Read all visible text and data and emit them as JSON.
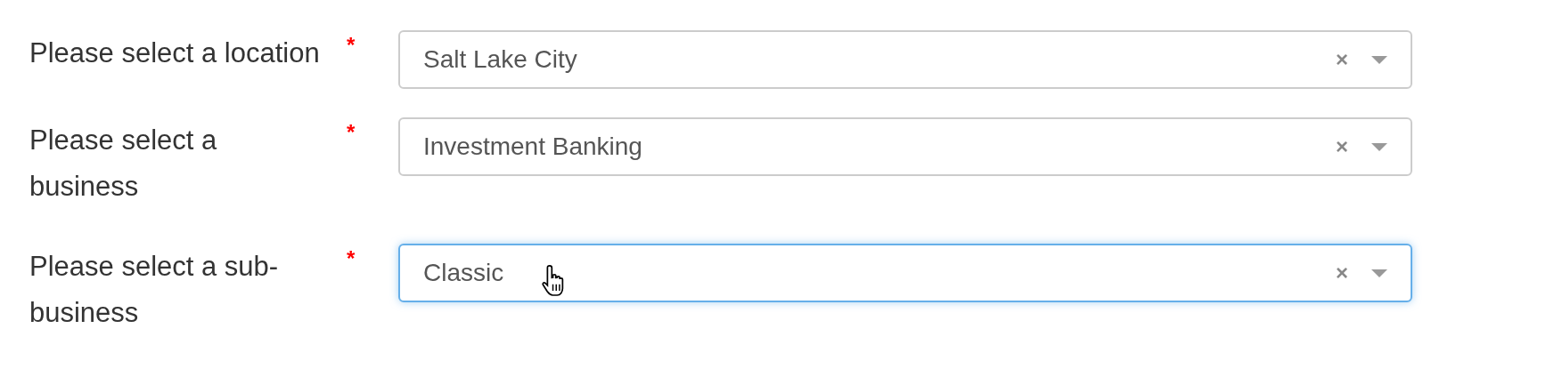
{
  "fields": [
    {
      "label": "Please select a location",
      "required_mark": "*",
      "value": "Salt Lake City",
      "clear": "×",
      "focused": false,
      "hovered": false
    },
    {
      "label": "Please select a business",
      "required_mark": "*",
      "value": "Investment Banking",
      "clear": "×",
      "focused": false,
      "hovered": false
    },
    {
      "label": "Please select a sub-business",
      "required_mark": "*",
      "value": "Classic",
      "clear": "×",
      "focused": true,
      "hovered": true
    }
  ]
}
